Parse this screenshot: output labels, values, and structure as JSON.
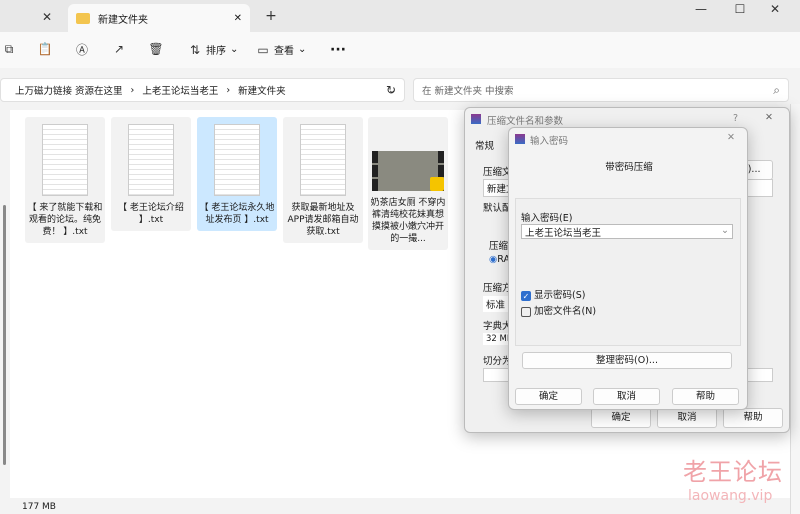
{
  "window": {
    "tab_title": "新建文件夹",
    "new_tab": "+",
    "close": "✕",
    "minimize": "—",
    "maximize": "☐",
    "window_close": "✕"
  },
  "toolbar": {
    "sort": "排序",
    "view": "查看",
    "more": "···"
  },
  "address": {
    "crumbs": [
      "上万磁力链接 资源在这里",
      "上老王论坛当老王",
      "新建文件夹"
    ],
    "search_placeholder": "在 新建文件夹 中搜索"
  },
  "files": [
    {
      "name": "【 来了就能下载和观看的论坛。纯免费！ 】.txt",
      "type": "txt",
      "selected": false
    },
    {
      "name": "【 老王论坛介绍 】.txt",
      "type": "txt",
      "selected": false
    },
    {
      "name": "【 老王论坛永久地址发布页 】.txt",
      "type": "txt",
      "selected": true
    },
    {
      "name": "获取最新地址及APP请发邮箱自动获取.txt",
      "type": "txt",
      "selected": false
    },
    {
      "name": "奶茶店女厕 不穿内裤清纯校花妹真想摸摸被小嫩穴冲开的一撮...",
      "type": "video",
      "selected": false
    }
  ],
  "status": {
    "size": "177 MB"
  },
  "archive_dialog": {
    "title": "压缩文件名和参数",
    "help": "?",
    "tab": "常规",
    "archive_name_label": "压缩文",
    "archive_name_value": "新建文",
    "browse": "(B)...",
    "profile_label": "默认配",
    "format_label": "压缩",
    "format_option": "RA",
    "method_label": "压缩方",
    "method_value": "标准",
    "dict_label": "字典大",
    "dict_value": "32 MB",
    "split_label": "切分为",
    "ok": "确定",
    "cancel": "取消",
    "help_btn": "帮助"
  },
  "password_dialog": {
    "title": "输入密码",
    "heading": "带密码压缩",
    "password_label": "输入密码(E)",
    "password_value": "上老王论坛当老王",
    "show_password": "显示密码(S)",
    "show_password_checked": true,
    "encrypt_names": "加密文件名(N)",
    "encrypt_names_checked": false,
    "organize": "整理密码(O)...",
    "ok": "确定",
    "cancel": "取消",
    "help": "帮助"
  },
  "watermark": {
    "cn": "老王论坛",
    "url": "laowang.vip"
  },
  "colors": {
    "accent": "#2f6fce",
    "selection": "#cce8ff",
    "watermark": "#f0a3a8"
  }
}
